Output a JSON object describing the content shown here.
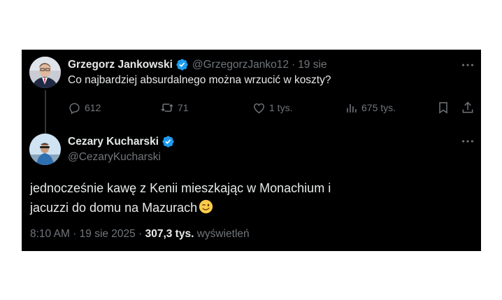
{
  "quoted_tweet": {
    "author_name": "Grzegorz Jankowski",
    "handle": "@GrzegorzJanko12",
    "separator": "·",
    "date": "19 sie",
    "text": "Co najbardziej absurdalnego można wrzucić w koszty?",
    "replies": "612",
    "retweets": "71",
    "likes": "1 tys.",
    "views": "675 tys.",
    "verified": true
  },
  "reply_tweet": {
    "author_name": "Cezary Kucharski",
    "handle": "@CezaryKucharski",
    "text_line1": "jednocześnie kawę z Kenii mieszkając w Monachium i",
    "text_line2": "jacuzzi do domu na Mazurach",
    "emoji": "winking-face",
    "timestamp": "8:10 AM · 19 sie 2025 ·",
    "views_count": "307,3 tys.",
    "views_label": "wyświetleń",
    "verified": true
  },
  "colors": {
    "background": "#000000",
    "text": "#e7e9ea",
    "secondary": "#71767b",
    "verified_blue": "#1d9bf0"
  },
  "icons": [
    "reply-icon",
    "retweet-icon",
    "like-icon",
    "views-icon",
    "bookmark-icon",
    "share-icon",
    "more-icon",
    "verified-badge-icon"
  ]
}
